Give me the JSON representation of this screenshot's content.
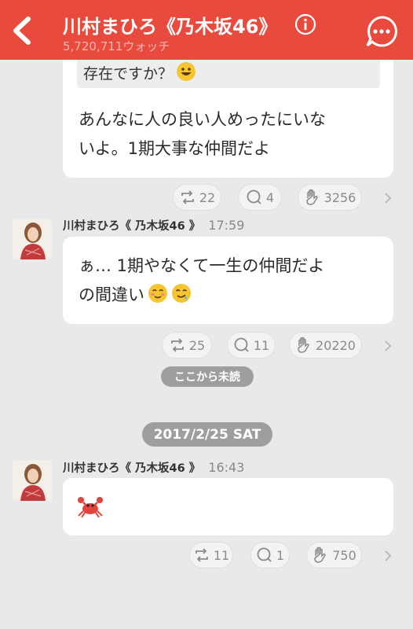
{
  "header": {
    "title": "川村まひろ《乃木坂46》",
    "watchers": "5,720,711ウォッチ",
    "accent": "#e84a3d"
  },
  "messages": [
    {
      "quote": "存在ですか？",
      "text_lines": [
        "あんなに人の良い人めったにいな",
        "いよ。1期大事な仲間だよ"
      ],
      "actions": {
        "retweets": "22",
        "replies": "4",
        "claps": "3256"
      }
    },
    {
      "sender": "川村まひろ《 乃木坂46 》",
      "time": "17:59",
      "text_lines": [
        "ぁ… 1期やなくて一生の仲間だよ",
        "の間違い"
      ],
      "actions": {
        "retweets": "25",
        "replies": "11",
        "claps": "20220"
      }
    },
    {
      "sender": "川村まひろ《 乃木坂46 》",
      "time": "16:43",
      "text": "",
      "actions": {
        "retweets": "11",
        "replies": "1",
        "claps": "750"
      }
    }
  ],
  "unread_marker": "ここから未読",
  "date_marker": "2017/2/25 SAT",
  "icons": [
    "back-arrow-icon",
    "info-icon",
    "chat-bubble-icon",
    "smile-emoji-icon",
    "relieved-emoji-icon",
    "drool-emoji-icon",
    "crab-emoji-icon",
    "retweet-icon",
    "reply-icon",
    "clap-icon",
    "chevron-right-icon"
  ]
}
